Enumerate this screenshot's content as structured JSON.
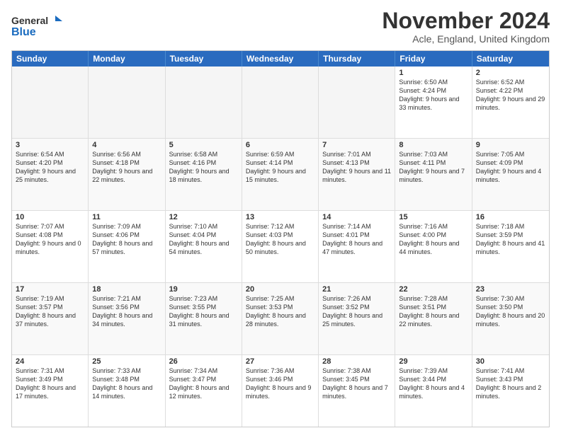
{
  "logo": {
    "general": "General",
    "blue": "Blue"
  },
  "title": "November 2024",
  "location": "Acle, England, United Kingdom",
  "header_days": [
    "Sunday",
    "Monday",
    "Tuesday",
    "Wednesday",
    "Thursday",
    "Friday",
    "Saturday"
  ],
  "weeks": [
    [
      {
        "day": "",
        "info": ""
      },
      {
        "day": "",
        "info": ""
      },
      {
        "day": "",
        "info": ""
      },
      {
        "day": "",
        "info": ""
      },
      {
        "day": "",
        "info": ""
      },
      {
        "day": "1",
        "info": "Sunrise: 6:50 AM\nSunset: 4:24 PM\nDaylight: 9 hours and 33 minutes."
      },
      {
        "day": "2",
        "info": "Sunrise: 6:52 AM\nSunset: 4:22 PM\nDaylight: 9 hours and 29 minutes."
      }
    ],
    [
      {
        "day": "3",
        "info": "Sunrise: 6:54 AM\nSunset: 4:20 PM\nDaylight: 9 hours and 25 minutes."
      },
      {
        "day": "4",
        "info": "Sunrise: 6:56 AM\nSunset: 4:18 PM\nDaylight: 9 hours and 22 minutes."
      },
      {
        "day": "5",
        "info": "Sunrise: 6:58 AM\nSunset: 4:16 PM\nDaylight: 9 hours and 18 minutes."
      },
      {
        "day": "6",
        "info": "Sunrise: 6:59 AM\nSunset: 4:14 PM\nDaylight: 9 hours and 15 minutes."
      },
      {
        "day": "7",
        "info": "Sunrise: 7:01 AM\nSunset: 4:13 PM\nDaylight: 9 hours and 11 minutes."
      },
      {
        "day": "8",
        "info": "Sunrise: 7:03 AM\nSunset: 4:11 PM\nDaylight: 9 hours and 7 minutes."
      },
      {
        "day": "9",
        "info": "Sunrise: 7:05 AM\nSunset: 4:09 PM\nDaylight: 9 hours and 4 minutes."
      }
    ],
    [
      {
        "day": "10",
        "info": "Sunrise: 7:07 AM\nSunset: 4:08 PM\nDaylight: 9 hours and 0 minutes."
      },
      {
        "day": "11",
        "info": "Sunrise: 7:09 AM\nSunset: 4:06 PM\nDaylight: 8 hours and 57 minutes."
      },
      {
        "day": "12",
        "info": "Sunrise: 7:10 AM\nSunset: 4:04 PM\nDaylight: 8 hours and 54 minutes."
      },
      {
        "day": "13",
        "info": "Sunrise: 7:12 AM\nSunset: 4:03 PM\nDaylight: 8 hours and 50 minutes."
      },
      {
        "day": "14",
        "info": "Sunrise: 7:14 AM\nSunset: 4:01 PM\nDaylight: 8 hours and 47 minutes."
      },
      {
        "day": "15",
        "info": "Sunrise: 7:16 AM\nSunset: 4:00 PM\nDaylight: 8 hours and 44 minutes."
      },
      {
        "day": "16",
        "info": "Sunrise: 7:18 AM\nSunset: 3:59 PM\nDaylight: 8 hours and 41 minutes."
      }
    ],
    [
      {
        "day": "17",
        "info": "Sunrise: 7:19 AM\nSunset: 3:57 PM\nDaylight: 8 hours and 37 minutes."
      },
      {
        "day": "18",
        "info": "Sunrise: 7:21 AM\nSunset: 3:56 PM\nDaylight: 8 hours and 34 minutes."
      },
      {
        "day": "19",
        "info": "Sunrise: 7:23 AM\nSunset: 3:55 PM\nDaylight: 8 hours and 31 minutes."
      },
      {
        "day": "20",
        "info": "Sunrise: 7:25 AM\nSunset: 3:53 PM\nDaylight: 8 hours and 28 minutes."
      },
      {
        "day": "21",
        "info": "Sunrise: 7:26 AM\nSunset: 3:52 PM\nDaylight: 8 hours and 25 minutes."
      },
      {
        "day": "22",
        "info": "Sunrise: 7:28 AM\nSunset: 3:51 PM\nDaylight: 8 hours and 22 minutes."
      },
      {
        "day": "23",
        "info": "Sunrise: 7:30 AM\nSunset: 3:50 PM\nDaylight: 8 hours and 20 minutes."
      }
    ],
    [
      {
        "day": "24",
        "info": "Sunrise: 7:31 AM\nSunset: 3:49 PM\nDaylight: 8 hours and 17 minutes."
      },
      {
        "day": "25",
        "info": "Sunrise: 7:33 AM\nSunset: 3:48 PM\nDaylight: 8 hours and 14 minutes."
      },
      {
        "day": "26",
        "info": "Sunrise: 7:34 AM\nSunset: 3:47 PM\nDaylight: 8 hours and 12 minutes."
      },
      {
        "day": "27",
        "info": "Sunrise: 7:36 AM\nSunset: 3:46 PM\nDaylight: 8 hours and 9 minutes."
      },
      {
        "day": "28",
        "info": "Sunrise: 7:38 AM\nSunset: 3:45 PM\nDaylight: 8 hours and 7 minutes."
      },
      {
        "day": "29",
        "info": "Sunrise: 7:39 AM\nSunset: 3:44 PM\nDaylight: 8 hours and 4 minutes."
      },
      {
        "day": "30",
        "info": "Sunrise: 7:41 AM\nSunset: 3:43 PM\nDaylight: 8 hours and 2 minutes."
      }
    ]
  ]
}
